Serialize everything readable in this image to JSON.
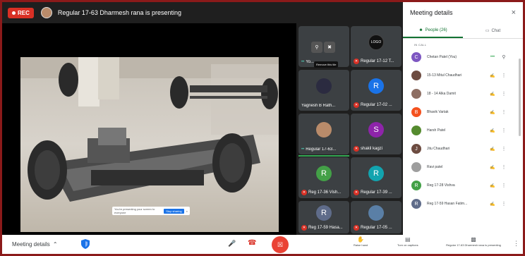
{
  "topbar": {
    "rec_label": "REC",
    "presenting_text": "Regular 17-63 Dharmesh rana is presenting"
  },
  "video": {
    "notice_text": "You're presenting your screen to everyone",
    "notice_button": "Stop sharing",
    "notice_close": "×"
  },
  "tiles": [
    {
      "name": "Yo...",
      "avatar": "",
      "color": "#3c4043",
      "muted": false,
      "speaking": true,
      "tooltip": "Remove this tile"
    },
    {
      "name": "Regular 17-12 T...",
      "avatar": "LOGO",
      "color": "#111111",
      "muted": true,
      "speaking": false
    },
    {
      "name": "Yagnesh B Rath...",
      "avatar": "",
      "color": "#2b2b40",
      "muted": false,
      "speaking": false
    },
    {
      "name": "Regular 17-02 ...",
      "avatar": "R",
      "color": "#1a73e8",
      "muted": true,
      "speaking": false
    },
    {
      "name": "Regular 17-63...",
      "avatar": "",
      "color": "#b98b6a",
      "muted": false,
      "speaking": true
    },
    {
      "name": "shakil kagzi",
      "avatar": "S",
      "color": "#8e24aa",
      "muted": true,
      "speaking": false
    },
    {
      "name": "Reg 17-36 Vish...",
      "avatar": "R",
      "color": "#43a047",
      "muted": true,
      "speaking": false
    },
    {
      "name": "Regular 17-39 ...",
      "avatar": "R",
      "color": "#12a4af",
      "muted": true,
      "speaking": false
    },
    {
      "name": "Reg 17-59 Hasa...",
      "avatar": "R",
      "color": "#5f6c8a",
      "muted": true,
      "speaking": false
    },
    {
      "name": "Regular 17-05 ...",
      "avatar": "",
      "color": "#5a7fa6",
      "muted": true,
      "speaking": false
    }
  ],
  "panel": {
    "title": "Meeting details",
    "close": "×",
    "tab_people": "People (26)",
    "tab_chat": "Chat",
    "section_label": "IN CALL",
    "people": [
      {
        "name": "Chetan Patel (You)",
        "initial": "C",
        "color": "#7e57c2",
        "speaking": true
      },
      {
        "name": "15-13 Mitul Chaudhari",
        "initial": "",
        "color": "#6d4c41",
        "speaking": false
      },
      {
        "name": "18 - 14 Alka Damit",
        "initial": "",
        "color": "#8d6e63",
        "speaking": false
      },
      {
        "name": "Bhavik Vartak",
        "initial": "B",
        "color": "#f4511e",
        "speaking": false
      },
      {
        "name": "Harsh Patel",
        "initial": "",
        "color": "#558b2f",
        "speaking": false
      },
      {
        "name": "Jitu Chaudhari",
        "initial": "J",
        "color": "#6d4c41",
        "speaking": false
      },
      {
        "name": "Ravi patel",
        "initial": "",
        "color": "#9e9e9e",
        "speaking": false
      },
      {
        "name": "Reg 17-28 Vishva",
        "initial": "R",
        "color": "#43a047",
        "speaking": false
      },
      {
        "name": "Reg 17-59 Hasan Fatim...",
        "initial": "R",
        "color": "#5f6c8a",
        "speaking": false
      }
    ]
  },
  "bottombar": {
    "meeting_details": "Meeting details",
    "raise_hand": "Raise hand",
    "captions": "Turn on captions",
    "presenting": "Regular 17-63 Dharmesh rana is presenting"
  }
}
